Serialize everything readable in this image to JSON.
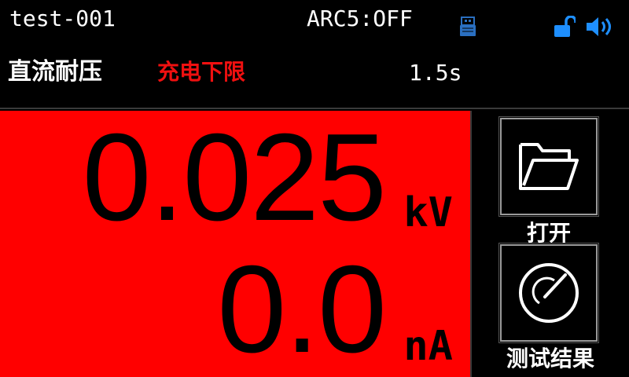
{
  "header": {
    "file_name": "test-001",
    "arc_status": "ARC5:OFF",
    "icons": [
      "usb-icon",
      "unlock-icon",
      "speaker-icon"
    ],
    "icon_color": "#1e8fff"
  },
  "status_row": {
    "mode": "直流耐压",
    "status": "充电下限",
    "status_color": "#f01010",
    "time": "1.5s"
  },
  "readout": {
    "background": "#ff0000",
    "voltage_value": "0.025",
    "voltage_unit": "kV",
    "current_value": "0.0",
    "current_unit": "nA"
  },
  "side_buttons": {
    "open_label": "打开",
    "open_icon": "folder-icon",
    "result_label": "测试结果",
    "result_icon": "gauge-icon"
  }
}
